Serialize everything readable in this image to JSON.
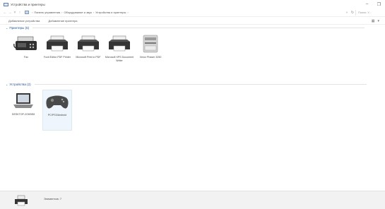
{
  "window": {
    "title": "Устройства и принтеры",
    "controls": {
      "minimize": "–",
      "restore": "❐"
    }
  },
  "address_bar": {
    "nav": {
      "back": "←",
      "forward": "→",
      "dropdown": "˅",
      "up": "↑"
    },
    "breadcrumbs": [
      "Панель управления",
      "Оборудование и звук",
      "Устройства и принтеры"
    ],
    "breadcrumb_sep": "›",
    "dropdown": "˅",
    "refresh": "↻",
    "search_placeholder": "Поиск: У..."
  },
  "command_bar": {
    "add_device": "Добавление устройства",
    "add_printer": "Добавление принтера",
    "view_icon": "▦",
    "view_dropdown": "▾"
  },
  "sections": {
    "printers": {
      "header": "Принтеры (5)",
      "items": [
        {
          "label": "Fax",
          "icon": "fax-icon"
        },
        {
          "label": "Foxit Editor PDF Printer",
          "icon": "printer-icon"
        },
        {
          "label": "Microsoft Print to PDF",
          "icon": "printer-icon"
        },
        {
          "label": "Microsoft XPS Document Writer",
          "icon": "printer-icon"
        },
        {
          "label": "Xerox Phaser 3250",
          "icon": "laser-printer-icon"
        }
      ]
    },
    "devices": {
      "header": "Устройства (2)",
      "items": [
        {
          "label": "DESKTOP-2OKBE8",
          "icon": "laptop-icon"
        },
        {
          "label": "PC/PS3/Android",
          "icon": "gamepad-icon"
        }
      ]
    }
  },
  "status_bar": {
    "text": "Элементов: 7",
    "icon": "printer-icon"
  },
  "colors": {
    "section_header": "#1e4e8c",
    "selection": "#eef5fc",
    "status_bg": "#f2f2f2"
  }
}
